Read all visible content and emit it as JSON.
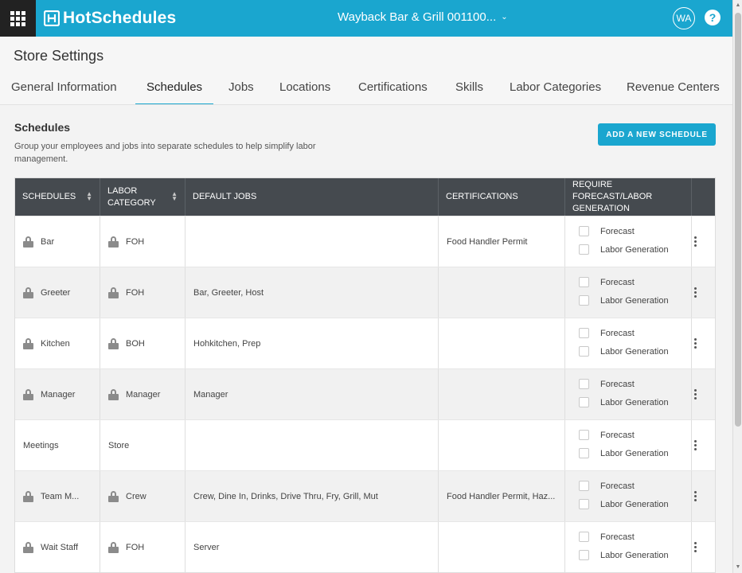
{
  "app": {
    "brand": "HotSchedules",
    "store_name": "Wayback Bar & Grill 001100...",
    "user_initials": "WA",
    "help_label": "?",
    "colors": {
      "accent": "#1aa6cf",
      "header_dark": "#454a4f",
      "apps_bg": "#222222"
    }
  },
  "page": {
    "title": "Store Settings",
    "tabs": [
      {
        "label": "General Information"
      },
      {
        "label": "Schedules",
        "active": true
      },
      {
        "label": "Jobs"
      },
      {
        "label": "Locations"
      },
      {
        "label": "Certifications"
      },
      {
        "label": "Skills"
      },
      {
        "label": "Labor Categories"
      },
      {
        "label": "Revenue Centers"
      }
    ]
  },
  "section": {
    "title": "Schedules",
    "description": "Group your employees and jobs into separate schedules to help simplify labor management.",
    "add_button": "ADD A NEW SCHEDULE"
  },
  "table": {
    "headers": {
      "schedules": "SCHEDULES",
      "labor_category": "LABOR CATEGORY",
      "default_jobs": "DEFAULT JOBS",
      "certifications": "CERTIFICATIONS",
      "require": "REQUIRE FORECAST/LABOR GENERATION"
    },
    "checkbox_labels": {
      "forecast": "Forecast",
      "labor": "Labor Generation"
    },
    "rows": [
      {
        "schedule": "Bar",
        "locked": true,
        "category": "FOH",
        "category_locked": true,
        "jobs": "",
        "certs": "Food Handler Permit",
        "forecast": false,
        "labor": false
      },
      {
        "schedule": "Greeter",
        "locked": true,
        "category": "FOH",
        "category_locked": true,
        "jobs": "Bar, Greeter, Host",
        "certs": "",
        "forecast": false,
        "labor": false
      },
      {
        "schedule": "Kitchen",
        "locked": true,
        "category": "BOH",
        "category_locked": true,
        "jobs": "Hohkitchen, Prep",
        "certs": "",
        "forecast": false,
        "labor": false
      },
      {
        "schedule": "Manager",
        "locked": true,
        "category": "Manager",
        "category_locked": true,
        "jobs": "Manager",
        "certs": "",
        "forecast": false,
        "labor": false
      },
      {
        "schedule": "Meetings",
        "locked": false,
        "category": "Store",
        "category_locked": false,
        "jobs": "",
        "certs": "",
        "forecast": false,
        "labor": false
      },
      {
        "schedule": "Team M...",
        "locked": true,
        "category": "Crew",
        "category_locked": true,
        "jobs": "Crew, Dine In, Drinks, Drive Thru, Fry, Grill, Mut",
        "certs": "Food Handler Permit, Haz...",
        "forecast": false,
        "labor": false
      },
      {
        "schedule": "Wait Staff",
        "locked": true,
        "category": "FOH",
        "category_locked": true,
        "jobs": "Server",
        "certs": "",
        "forecast": false,
        "labor": false
      }
    ]
  }
}
